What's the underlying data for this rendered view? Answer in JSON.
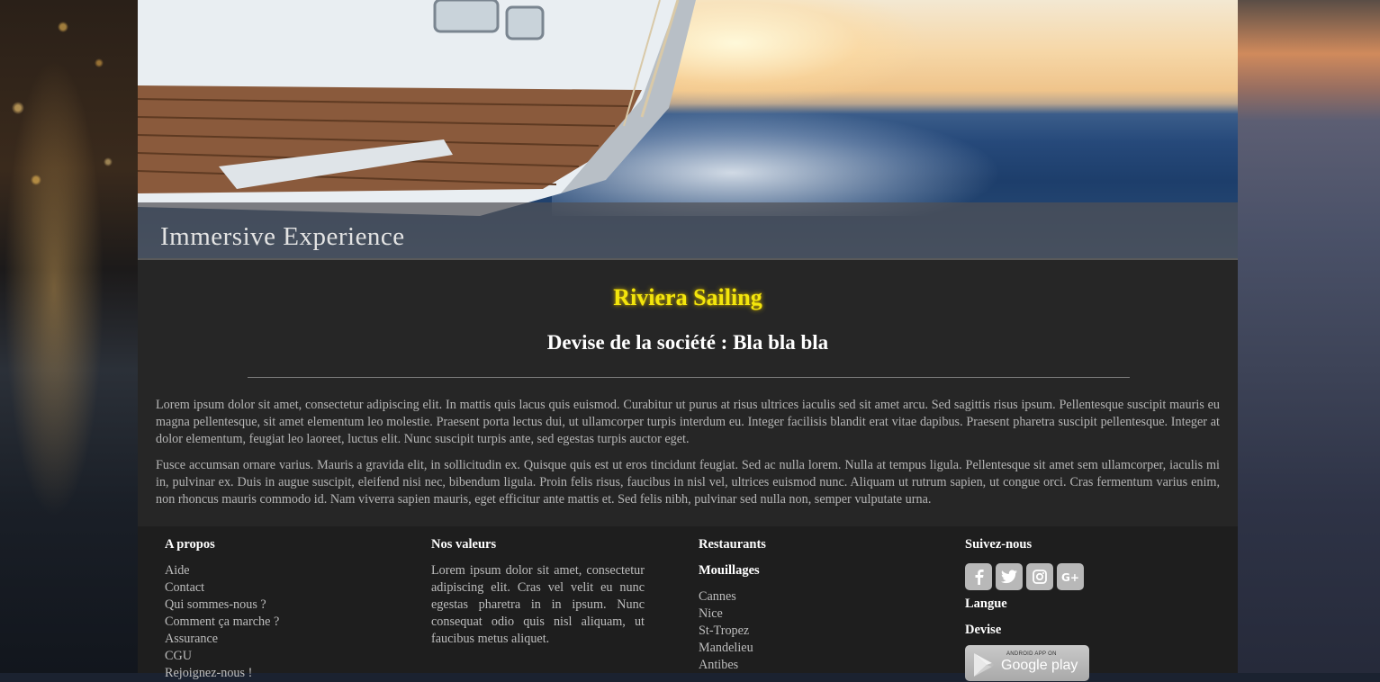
{
  "hero": {
    "caption": "Immersive Experience"
  },
  "main": {
    "brand": "Riviera Sailing",
    "motto": "Devise de la société : Bla bla bla",
    "paragraphs": [
      "Lorem ipsum dolor sit amet, consectetur adipiscing elit. In mattis quis lacus quis euismod. Curabitur ut purus at risus ultrices iaculis sed sit amet arcu. Sed sagittis risus ipsum. Pellentesque suscipit mauris eu magna pellentesque, sit amet elementum leo molestie. Praesent porta lectus dui, ut ullamcorper turpis interdum eu. Integer facilisis blandit erat vitae dapibus. Praesent pharetra suscipit pellentesque. Integer at dolor elementum, feugiat leo laoreet, luctus elit. Nunc suscipit turpis ante, sed egestas turpis auctor eget.",
      "Fusce accumsan ornare varius. Mauris a gravida elit, in sollicitudin ex. Quisque quis est ut eros tincidunt feugiat. Sed ac nulla lorem. Nulla at tempus ligula. Pellentesque sit amet sem ullamcorper, iaculis mi in, pulvinar ex. Duis in augue suscipit, eleifend nisi nec, bibendum ligula. Proin felis risus, faucibus in nisl vel, ultrices euismod nunc. Aliquam ut rutrum sapien, ut congue orci. Cras fermentum varius enim, non rhoncus mauris commodo id. Nam viverra sapien mauris, eget efficitur ante mattis et. Sed felis nibh, pulvinar sed nulla non, semper vulputate urna."
    ]
  },
  "footer": {
    "about": {
      "title": "A propos",
      "links": [
        "Aide",
        "Contact",
        "Qui sommes-nous ?",
        "Comment ça marche ?",
        "Assurance",
        "CGU",
        "Rejoignez-nous !"
      ]
    },
    "values": {
      "title": "Nos valeurs",
      "text": "Lorem ipsum dolor sit amet, consectetur adipiscing elit. Cras vel velit eu nunc egestas pharetra in in ipsum. Nunc consequat odio quis nisl aliquam, ut faucibus metus aliquet."
    },
    "places": {
      "restaurants": "Restaurants",
      "moorings": "Mouillages",
      "links": [
        "Cannes",
        "Nice",
        "St-Tropez",
        "Mandelieu",
        "Antibes"
      ]
    },
    "follow": {
      "title": "Suivez-nous",
      "social": [
        "facebook-icon",
        "twitter-icon",
        "instagram-icon",
        "google-plus-icon"
      ],
      "language": "Langue",
      "currency": "Devise",
      "store_small": "ANDROID APP ON",
      "store_big": "Google play"
    }
  },
  "colors": {
    "brand": "#f3e60c",
    "container": "#262626",
    "footer": "#1e1e1e"
  }
}
